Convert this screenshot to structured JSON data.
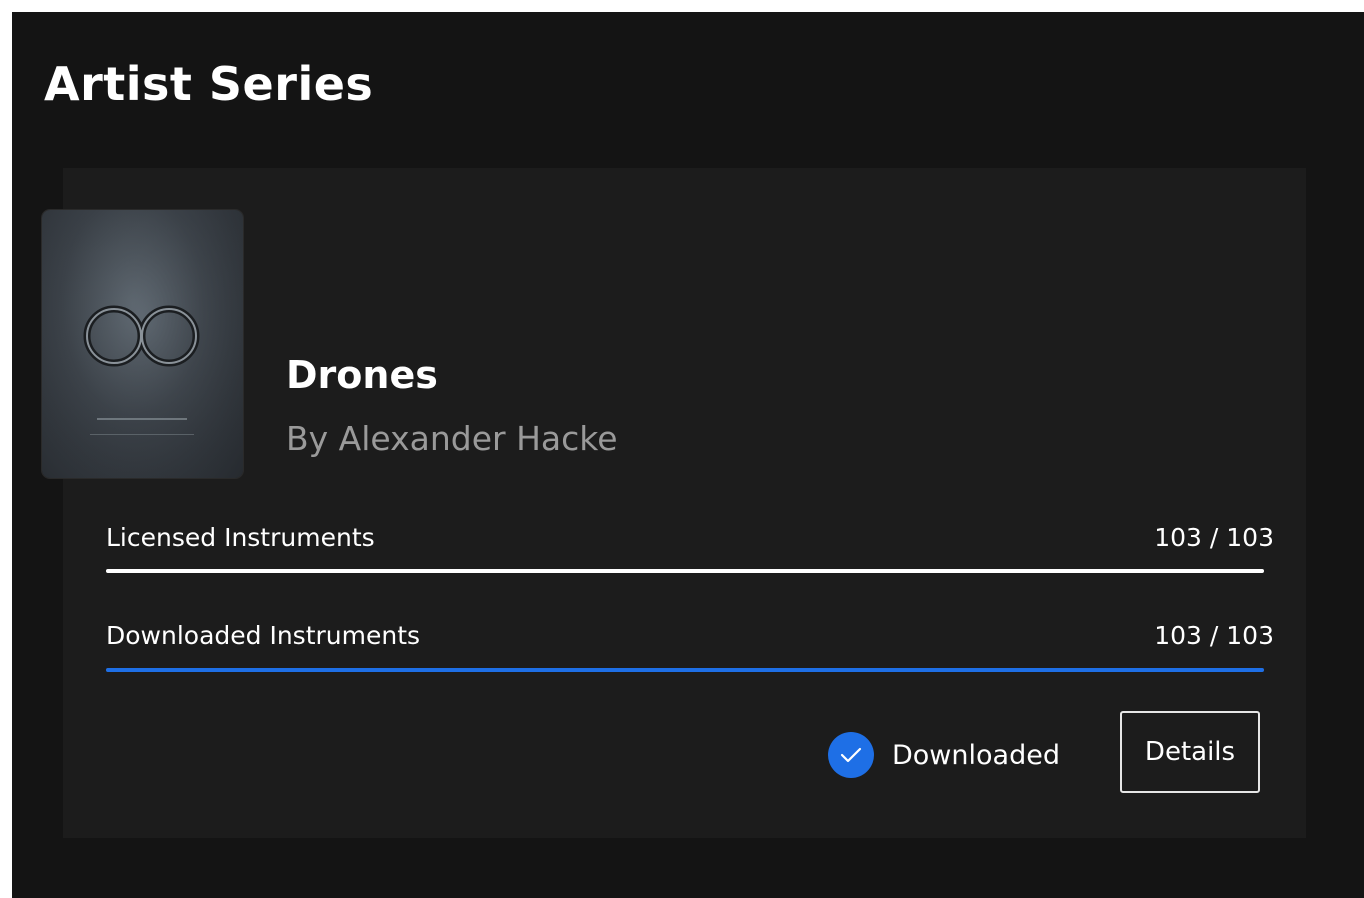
{
  "section": {
    "title": "Artist Series"
  },
  "product": {
    "name": "Drones",
    "artist": "By Alexander Hacke",
    "cover_icon": "infinity-artwork"
  },
  "licensed": {
    "label": "Licensed Instruments",
    "count": "103 / 103",
    "progress": 1.0,
    "color": "#ffffff"
  },
  "downloaded": {
    "label": "Downloaded Instruments",
    "count": "103 / 103",
    "progress": 1.0,
    "color": "#1e6fe6"
  },
  "status": {
    "icon": "check-circle-icon",
    "label": "Downloaded",
    "accent": "#1e6fe6"
  },
  "actions": {
    "details_label": "Details"
  }
}
